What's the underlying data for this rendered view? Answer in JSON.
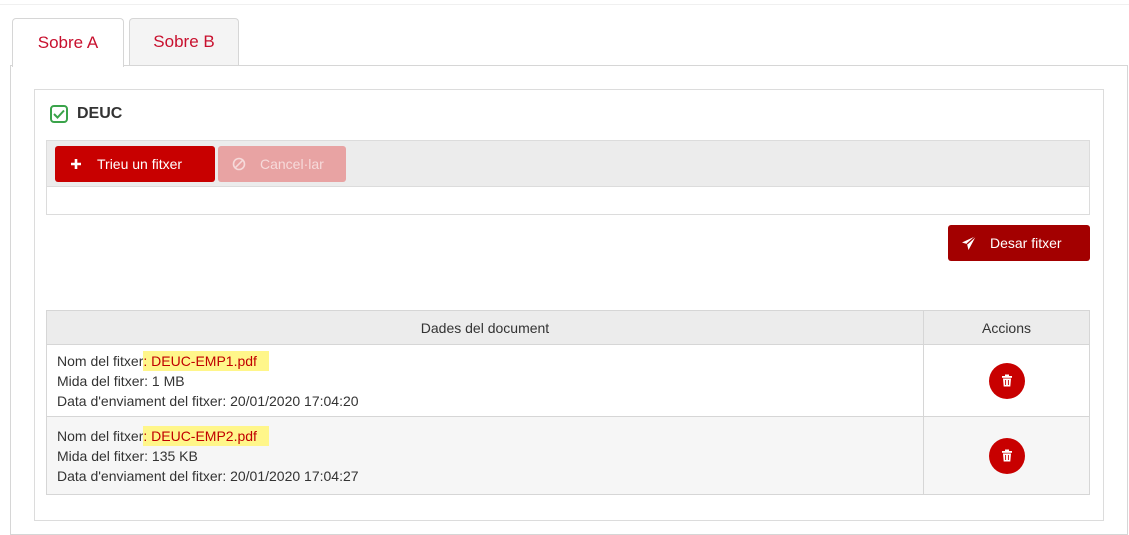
{
  "tabs": [
    {
      "label": "Sobre A",
      "active": true
    },
    {
      "label": "Sobre B",
      "active": false
    }
  ],
  "section": {
    "title": "DEUC",
    "checked": true
  },
  "upload": {
    "choose_label": "Trieu un fitxer",
    "cancel_label": "Cancel·lar"
  },
  "save_label": "Desar fitxer",
  "table": {
    "headers": [
      "Dades del document",
      "Accions"
    ],
    "rows": [
      {
        "name_label": "Nom del fitxer",
        "name_sep": ":",
        "name_value": " DEUC-EMP1.pdf",
        "size_label": "Mida del fitxer:",
        "size_value": " 1 MB",
        "date_label": "Data d'enviament del fitxer:",
        "date_value": " 20/01/2020 17:04:20"
      },
      {
        "name_label": "Nom del fitxer",
        "name_sep": ":",
        "name_value": " DEUC-EMP2.pdf",
        "size_label": "Mida del fitxer:",
        "size_value": " 135 KB",
        "date_label": "Data d'enviament del fitxer:",
        "date_value": " 20/01/2020 17:04:27"
      }
    ]
  },
  "colors": {
    "primary": "#c80000",
    "primary_dark": "#a30000",
    "disabled": "#e8a3a3",
    "highlight": "#fff68a",
    "check": "#3aa34a"
  },
  "icons": {
    "check": "check-square-icon",
    "plus": "plus-icon",
    "cancel": "ban-icon",
    "save": "paper-plane-icon",
    "delete": "trash-icon"
  }
}
